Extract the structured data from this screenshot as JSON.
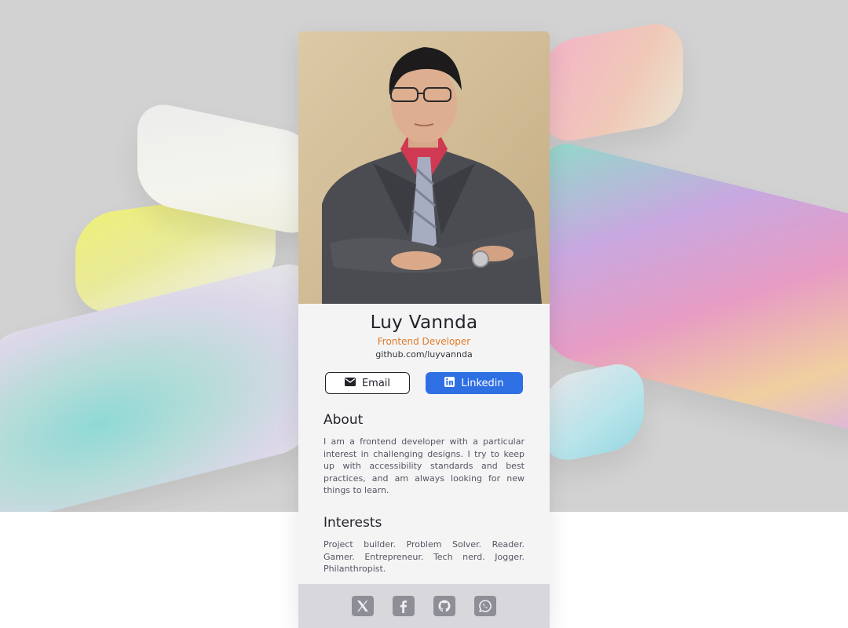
{
  "profile": {
    "name": "Luy Vannda",
    "title": "Frontend Developer",
    "website": "github.com/luyvannda"
  },
  "buttons": {
    "email_label": "Email",
    "email_icon": "envelope-icon",
    "linkedin_label": "Linkedin",
    "linkedin_icon": "linkedin-icon"
  },
  "about": {
    "heading": "About",
    "text": "I am a frontend developer with a particular interest in challenging designs. I try to keep up with accessibility standards and best practices, and am always looking for new things to learn."
  },
  "interests": {
    "heading": "Interests",
    "text": "Project builder. Problem Solver. Reader. Gamer. Entrepreneur. Tech nerd. Jogger. Philanthropist."
  },
  "social": [
    "x-twitter-icon",
    "facebook-icon",
    "github-icon",
    "whatsapp-icon"
  ],
  "colors": {
    "accent": "#e07b2a",
    "linkedin": "#2f6fe4",
    "text_dark": "#22232a",
    "card_bg": "#f4f4f5",
    "footer_bg": "#d8d7dc",
    "backdrop": "#d2d2d2"
  }
}
